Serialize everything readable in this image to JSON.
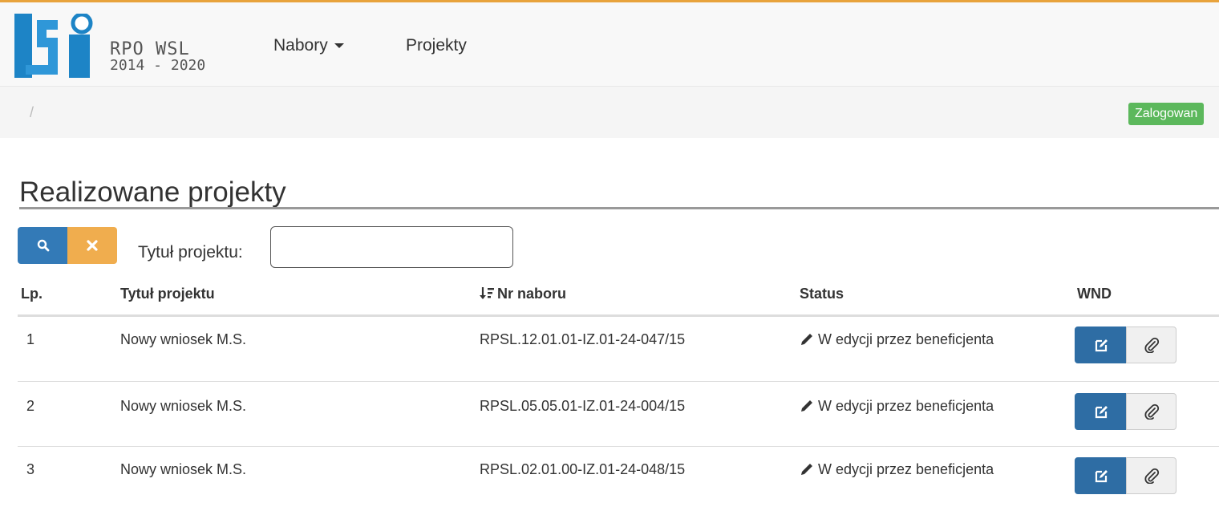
{
  "brand": {
    "logo_letters": "LSi",
    "line1": "RPO WSL",
    "line2": "2014 - 2020"
  },
  "nav": {
    "items": [
      {
        "label": "Nabory",
        "has_dropdown": true
      },
      {
        "label": "Projekty",
        "has_dropdown": false
      }
    ]
  },
  "breadcrumb": {
    "separator": "/"
  },
  "user": {
    "badge_text": "Zalogowan"
  },
  "page": {
    "title": "Realizowane projekty"
  },
  "filter": {
    "label": "Tytuł projektu:",
    "value": "",
    "search_icon": "search-icon",
    "clear_icon": "close-icon"
  },
  "table": {
    "headers": {
      "lp": "Lp.",
      "title": "Tytuł projektu",
      "nr": "Nr naboru",
      "status": "Status",
      "wnd": "WND"
    },
    "sort_icon": "sort-amount-desc-icon",
    "rows": [
      {
        "lp": "1",
        "title": "Nowy wniosek M.S.",
        "nr": "RPSL.12.01.01-IZ.01-24-047/15",
        "status": "W edycji przez beneficjenta"
      },
      {
        "lp": "2",
        "title": "Nowy wniosek M.S.",
        "nr": "RPSL.05.05.01-IZ.01-24-004/15",
        "status": "W edycji przez beneficjenta"
      },
      {
        "lp": "3",
        "title": "Nowy wniosek M.S.",
        "nr": "RPSL.02.01.00-IZ.01-24-048/15",
        "status": "W edycji przez beneficjenta"
      }
    ]
  },
  "colors": {
    "primary": "#337ab7",
    "warning": "#f0ad4e",
    "success": "#5cb85c",
    "accent_line": "#e8a33c"
  }
}
